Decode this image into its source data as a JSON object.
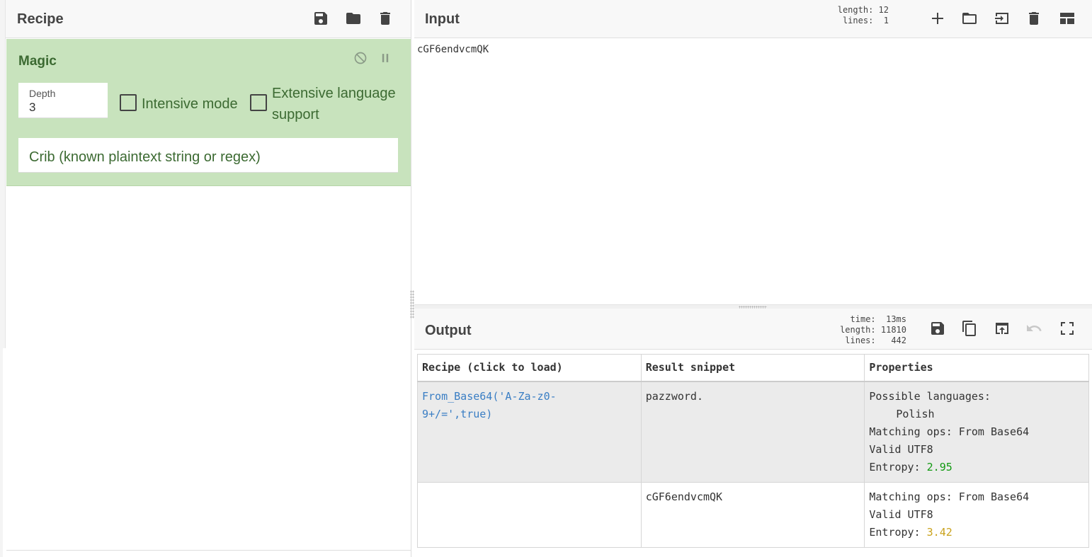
{
  "recipe": {
    "title": "Recipe",
    "icons": [
      "save-icon",
      "folder-icon",
      "trash-icon"
    ],
    "operation": {
      "name": "Magic",
      "depth_label": "Depth",
      "depth_value": "3",
      "intensive_label": "Intensive mode",
      "intensive_checked": false,
      "extensive_label_line1": "Extensive language",
      "extensive_label_line2": "support",
      "extensive_checked": false,
      "crib_placeholder": "Crib (known plaintext string or regex)"
    }
  },
  "input": {
    "title": "Input",
    "length_label": "length:",
    "length_value": "12",
    "lines_label": "lines:",
    "lines_value": "1",
    "text": "cGF6endvcmQK",
    "icons": [
      "plus-icon",
      "folder-icon",
      "import-icon",
      "trash-icon",
      "layout-icon"
    ]
  },
  "output": {
    "title": "Output",
    "time_label": "time:",
    "time_value": "13ms",
    "length_label": "length:",
    "length_value": "11810",
    "lines_label": "lines:",
    "lines_value": "442",
    "icons": [
      "save-icon",
      "copy-icon",
      "replace-input-icon",
      "undo-icon",
      "fullscreen-icon"
    ],
    "table": {
      "headers": [
        "Recipe (click to load)",
        "Result snippet",
        "Properties"
      ],
      "rows": [
        {
          "recipe_line1": "From_Base64('A-Za-z0-",
          "recipe_line2": "9+/=',true)",
          "snippet": "pazzword.",
          "prop_lang_label": "Possible languages:",
          "prop_lang_value": "Polish",
          "prop_ops": "Matching ops: From Base64",
          "prop_utf8": "Valid UTF8",
          "prop_entropy_label": "Entropy:",
          "prop_entropy_value": "2.95"
        },
        {
          "recipe_line1": "",
          "recipe_line2": "",
          "snippet": "cGF6endvcmQK",
          "prop_ops": "Matching ops: From Base64",
          "prop_utf8": "Valid UTF8",
          "prop_entropy_label": "Entropy:",
          "prop_entropy_value": "3.42"
        }
      ]
    }
  },
  "colors": {
    "operation_bg": "#c8e3bd",
    "operation_text": "#3c6a32",
    "link": "#3a7ec4",
    "entropy_low": "#119911",
    "entropy_mid": "#c9a21c",
    "highlight_row": "#ebebeb"
  }
}
